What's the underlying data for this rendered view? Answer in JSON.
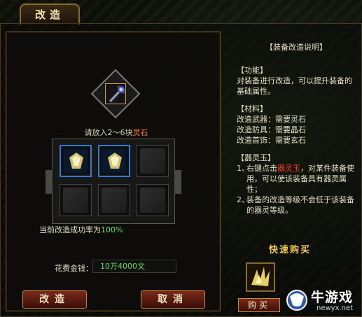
{
  "window": {
    "tab_label": "改造"
  },
  "upgrade_panel": {
    "hint_prefix": "请放入2～6块",
    "hint_highlight": "灵石",
    "success_prefix": "当前改造成功率为",
    "success_rate": "100%",
    "cost_label": "花费金钱：",
    "cost_value": "10万4000文",
    "confirm_label": "改造",
    "cancel_label": "取消",
    "slots": [
      {
        "filled": true,
        "item": "spirit-stone"
      },
      {
        "filled": true,
        "item": "spirit-stone"
      },
      {
        "filled": false,
        "item": ""
      },
      {
        "filled": false,
        "item": ""
      },
      {
        "filled": false,
        "item": ""
      },
      {
        "filled": false,
        "item": ""
      }
    ],
    "equipped_item": "staff-weapon-icon"
  },
  "info": {
    "title": "【装备改造说明】",
    "func_title": "【功能】",
    "func_body": "对装备进行改造，可以提升装备的基础属性。",
    "mat_title": "【材料】",
    "mat_lines": [
      "改造武器：需要灵石",
      "改造防具：需要晶石",
      "改造首饰：需要玄石"
    ],
    "soul_title": "【器灵玉】",
    "soul_1_num": "1、",
    "soul_1_pre": "右键点击",
    "soul_1_hl": "器灵玉",
    "soul_1_post": "，对某件装备使用，可以使该装备具有器灵属性；",
    "soul_2_num": "2、",
    "soul_2_body": "装备的改造等级不会低于该装备的器灵等级。"
  },
  "quick_buy": {
    "title": "快速购买",
    "buy_label": "购买",
    "item": "spirit-stone-icon"
  },
  "watermark": {
    "brand": "牛游戏",
    "url": "newyx.net"
  },
  "colors": {
    "accent_gold": "#c08a3a",
    "highlight_orange": "#ff7a2c",
    "highlight_red": "#ff3a2a",
    "rate_green": "#5fe05f",
    "slot_blue": "#2f7bd6"
  }
}
